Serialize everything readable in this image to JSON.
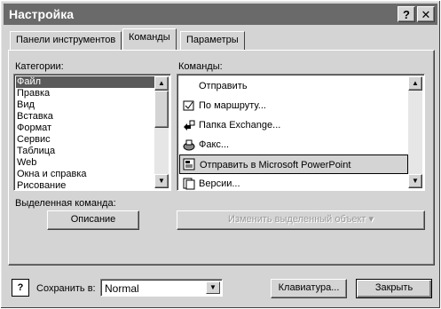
{
  "window": {
    "title": "Настройка",
    "help_btn": "?",
    "close_btn": "✕"
  },
  "tabs": [
    {
      "label": "Панели инструментов",
      "active": false
    },
    {
      "label": "Команды",
      "active": true
    },
    {
      "label": "Параметры",
      "active": false
    }
  ],
  "categories": {
    "label": "Категории:",
    "items": [
      "Файл",
      "Правка",
      "Вид",
      "Вставка",
      "Формат",
      "Сервис",
      "Таблица",
      "Web",
      "Окна и справка",
      "Рисование"
    ],
    "selected": "Файл"
  },
  "commands": {
    "label": "Команды:",
    "items": [
      {
        "label": "Отправить",
        "icon": "send-icon"
      },
      {
        "label": "По маршруту...",
        "icon": "routing-slip-icon"
      },
      {
        "label": "Папка Exchange...",
        "icon": "exchange-folder-icon"
      },
      {
        "label": "Факс...",
        "icon": "fax-icon"
      },
      {
        "label": "Отправить в Microsoft PowerPoint",
        "icon": "powerpoint-send-icon",
        "selected": true
      },
      {
        "label": "Версии...",
        "icon": "versions-icon"
      }
    ]
  },
  "selected_command": {
    "label": "Выделенная команда:",
    "describe_btn": "Описание",
    "modify_btn": "Изменить выделенный объект ▾"
  },
  "footer": {
    "save_in_label": "Сохранить в:",
    "save_in_value": "Normal",
    "keyboard_btn": "Клавиатура...",
    "close_btn": "Закрыть"
  }
}
